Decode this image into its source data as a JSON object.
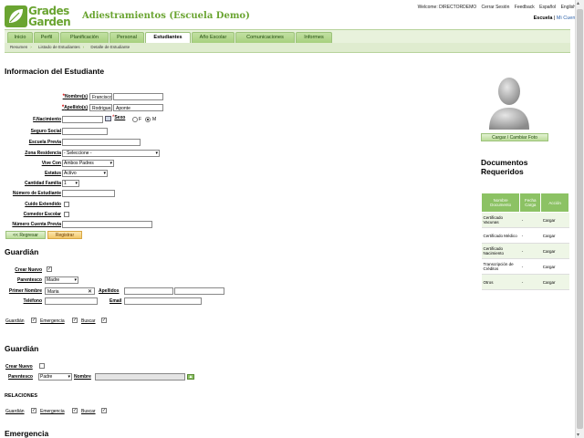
{
  "app": {
    "logo_line1": "Grades",
    "logo_line2": "Garden",
    "title": "Adiestramientos (Escuela Demo)"
  },
  "toplinks": [
    "Welcome: DIRECTORDEMO",
    "Cerrar Sesión",
    "Feedback",
    "Español",
    "English"
  ],
  "account": {
    "school": "Escuela",
    "separator": "|",
    "my_account": "Mi Cuenta"
  },
  "nav": {
    "tabs": [
      "Inicio",
      "Perfil",
      "Planificación",
      "Personal",
      "Estudiantes",
      "Año Escolar",
      "Comunicaciones",
      "Informes"
    ],
    "active": "Estudiantes"
  },
  "breadcrumb": [
    "Resumen",
    "Listado de Estudiantes",
    "Detalle de Estudiante"
  ],
  "student": {
    "heading": "Informacion del Estudiante",
    "labels": {
      "nombres": "Nombre(s)",
      "apellidos": "Apellido(s)",
      "nacimiento": "F.Nacimiento",
      "sexo": "Sexo",
      "sexo_f": "F",
      "sexo_m": "M",
      "seguro": "Seguro Social",
      "escuela": "Escuela Previa",
      "zona": "Zona Residencia",
      "vive": "Vive Con",
      "estatus": "Estatus",
      "familia": "Cantidad Familia",
      "numero": "Número de Estudiante",
      "cuido": "Cuido Extendido",
      "comedor": "Comedor Escolar",
      "cuenta": "Número Cuenta Previa"
    },
    "values": {
      "nombre1": "Francisco",
      "nombre2": "",
      "apellido1": "Rodriguez",
      "apellido2": "Aponte",
      "nacimiento": "",
      "sexo": "M",
      "seguro": "",
      "escuela": "",
      "zona": "- Seleccione -",
      "vive": "Ambos Padres",
      "estatus": "Activo",
      "familia": "1",
      "numero": "",
      "cuido": false,
      "comedor": false,
      "cuenta": ""
    },
    "required_mark": "*",
    "back_button": "<< Regresar",
    "register_button": "Registrar"
  },
  "guardian1": {
    "heading": "Guardián",
    "labels": {
      "crear": "Crear Nuevo",
      "parentesco": "Parentesco",
      "primer_nombre": "Primer Nombre",
      "apellidos": "Apellidos",
      "telefono": "Teléfono",
      "email": "Email",
      "guardian": "Guardián",
      "emergencia": "Emergencia",
      "buscar": "Buscar"
    },
    "values": {
      "crear": true,
      "parentesco": "Madre",
      "primer_nombre": "Maria",
      "apellido1": "",
      "apellido2": "",
      "telefono": "",
      "email": "",
      "guardian": true,
      "emergencia": true,
      "buscar": true
    }
  },
  "guardian2": {
    "heading": "Guardián",
    "labels": {
      "crear": "Crear Nuevo",
      "parentesco": "Parentesco",
      "nombre": "Nombre",
      "relaciones": "RELACIONES",
      "guardian": "Guardián",
      "emergencia": "Emergencia",
      "buscar": "Buscar"
    },
    "values": {
      "crear": false,
      "parentesco": "Padre",
      "nombre": "",
      "guardian": true,
      "emergencia": true,
      "buscar": true
    }
  },
  "emergencia_heading": "Emergencia",
  "photo": {
    "button": "Cargar / Cambiar Foto"
  },
  "documents": {
    "title_line1": "Documentos",
    "title_line2": "Requeridos",
    "headers": [
      "Nombre Documento",
      "Fecha Carga",
      "Acción"
    ],
    "rows": [
      [
        "Certificado Vacunas",
        "-",
        "Cargar"
      ],
      [
        "Certificado Médico",
        "-",
        "Cargar"
      ],
      [
        "Certificado Nacimiento",
        "-",
        "Cargar"
      ],
      [
        "Transcripción de Créditos",
        "-",
        "Cargar"
      ],
      [
        "Otros",
        "-",
        "Cargar"
      ]
    ]
  },
  "colors": {
    "brand_green": "#6aa431",
    "header_green": "#8cc264",
    "required_red": "#cc0000"
  }
}
